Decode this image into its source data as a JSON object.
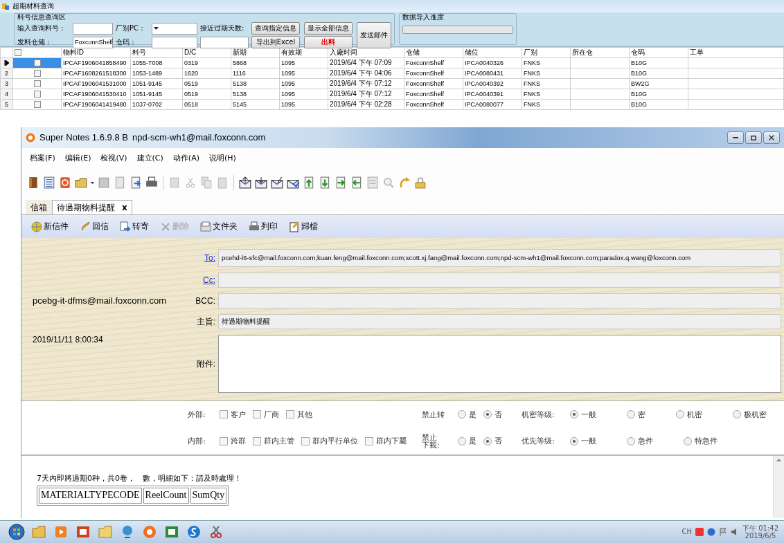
{
  "app": {
    "title": "超期材料查询",
    "query_group": {
      "title": "料号信息查询区",
      "part_field": {
        "label": "输入查询料号："
      },
      "plant_combo": {
        "label": "厂别PC："
      },
      "days_field": {
        "label": "接近过期天数:"
      },
      "warehouse_combo": {
        "label": "发料仓储：",
        "value": "FoxconnShelf"
      },
      "code_field": {
        "label": "仓码："
      },
      "buttons": [
        {
          "label": "查询指定信息",
          "kind": "normal"
        },
        {
          "label": "导出到Excel",
          "kind": "normal"
        },
        {
          "label": "显示全部信息",
          "kind": "normal"
        },
        {
          "label": "出料",
          "kind": "danger"
        },
        {
          "label": "发送邮件",
          "kind": "tall"
        }
      ]
    },
    "progress_group": {
      "title": "数据导入進度",
      "level": 0
    },
    "table": {
      "header_checked": false,
      "columns": [
        "物料ID",
        "料号",
        "D/C",
        "新期",
        "有效期",
        "入廠时间",
        "仓储",
        "储位",
        "厂别",
        "所在仓",
        "仓码",
        "工单"
      ],
      "rows": [
        {
          "selected": true,
          "checked": false,
          "cells": [
            "IPCAF1906041858490",
            "1055-T008",
            "0319",
            "5868",
            "1095",
            "2019/6/4 下午 07:09",
            "FoxconnShelf",
            "IPCA0040326",
            "FNKS",
            null,
            "B10G",
            null
          ]
        },
        {
          "number": "2",
          "selected": false,
          "checked": false,
          "cells": [
            "IPCAF1608261518300",
            "1053-1489",
            "1620",
            "1116",
            "1095",
            "2019/6/4 下午 04:06",
            "FoxconnShelf",
            "IPCA0080431",
            "FNKS",
            null,
            "B10G",
            null
          ]
        },
        {
          "number": "3",
          "selected": false,
          "checked": false,
          "cells": [
            "IPCAF1906041531000",
            "1051-9145",
            "0519",
            "5138",
            "1095",
            "2019/6/4 下午 07:12",
            "FoxconnShelf",
            "IPCA0040392",
            "FNKS",
            null,
            "BW2G",
            null
          ]
        },
        {
          "number": "4",
          "selected": false,
          "checked": false,
          "cells": [
            "IPCAF1906041530410",
            "1051-9145",
            "0519",
            "5138",
            "1095",
            "2019/6/4 下午 07:12",
            "FoxconnShelf",
            "IPCA0040391",
            "FNKS",
            null,
            "B10G",
            null
          ]
        },
        {
          "number": "5",
          "selected": false,
          "checked": false,
          "cells": [
            "IPCAF1906041419480",
            "1037-0702",
            "0518",
            "5145",
            "1095",
            "2019/6/4 下午 02:28",
            "FoxconnShelf",
            "IPCA0080077",
            "FNKS",
            null,
            "B10G",
            null
          ]
        }
      ]
    }
  },
  "mail_window": {
    "title": "Super Notes 1.6.9.8 B",
    "account": "npd-scm-wh1@mail.foxconn.com",
    "menu": [
      "档案(F)",
      "编辑(E)",
      "检视(V)",
      "建立(C)",
      "动作(A)",
      "说明(H)"
    ],
    "tabs": [
      {
        "label": "信箱",
        "selected": false
      },
      {
        "label": "待過期物料提醒",
        "selected": true,
        "close": "x"
      }
    ],
    "actions": [
      {
        "label": "新信件",
        "disabled": false
      },
      {
        "label": "回信",
        "disabled": false
      },
      {
        "label": "转寄",
        "disabled": false
      },
      {
        "label": "删除",
        "disabled": true
      },
      {
        "label": "文件夹",
        "disabled": false
      },
      {
        "label": "列印",
        "disabled": false
      },
      {
        "label": "歸檔",
        "disabled": false
      }
    ],
    "sender": "pcebg-it-dfms@mail.foxconn.com",
    "date": "2019/11/11 8:00:34",
    "fields": [
      {
        "label": "To:",
        "kind": "link",
        "value": "pcehd-l6-sfc@mail.foxconn.com;kuan.feng@mail.foxconn.com;scott.xj.fang@mail.foxconn.com;npd-scm-wh1@mail.foxconn.com;paradox.q.wang@foxconn.com"
      },
      {
        "label": "Cc:",
        "kind": "link"
      },
      {
        "label": "BCC:",
        "kind": "plain"
      },
      {
        "label": "主旨:",
        "kind": "plain",
        "value": "待過期物料提醒"
      },
      {
        "label": "附件:",
        "kind": "tall"
      }
    ],
    "options": {
      "external": {
        "label": "外部:",
        "items": [
          {
            "label": "客户",
            "checked": false
          },
          {
            "label": "厂商",
            "checked": false
          },
          {
            "label": "其他",
            "checked": false
          }
        ]
      },
      "no_forward": {
        "label": "禁止转",
        "choices": [
          {
            "label": "是",
            "selected": false
          },
          {
            "label": "否",
            "selected": true
          }
        ]
      },
      "confidentiality": {
        "label": "机密等级:",
        "choices": [
          {
            "label": "一般",
            "selected": true
          },
          {
            "label": "密",
            "selected": false
          },
          {
            "label": "机密",
            "selected": false
          },
          {
            "label": "极机密",
            "selected": false
          }
        ]
      },
      "internal": {
        "label": "内部:",
        "items": [
          {
            "label": "跨群",
            "checked": false
          },
          {
            "label": "群内主管",
            "checked": false
          },
          {
            "label": "群内平行单位",
            "checked": false
          },
          {
            "label": "群内下屬",
            "checked": false
          }
        ]
      },
      "no_download": {
        "label": "禁止下載:",
        "choices": [
          {
            "label": "是",
            "selected": false
          },
          {
            "label": "否",
            "selected": true
          }
        ]
      },
      "priority": {
        "label": "优先等级:",
        "choices": [
          {
            "label": "一般",
            "selected": true
          },
          {
            "label": "急件",
            "selected": false
          },
          {
            "label": "特急件",
            "selected": false
          }
        ]
      }
    },
    "body": {
      "text": "7天內即將過期0种，共0卷，　數，明細如下：請及時處理！",
      "columns": [
        "MATERIALTYPECODE",
        "ReelCount",
        "SumQty"
      ]
    }
  },
  "taskbar": {
    "language": "CH",
    "time": "下午 01:42",
    "date": "2019/6/5"
  }
}
